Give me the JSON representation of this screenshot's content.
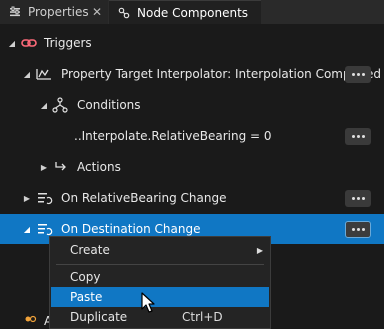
{
  "tabs": [
    {
      "label": "Properties",
      "icon": "properties-icon",
      "close": "✕"
    },
    {
      "label": "Node Components",
      "icon": "node-components-icon"
    }
  ],
  "tree": {
    "triggers": {
      "label": "Triggers",
      "icon": "link-icon"
    },
    "property_target": {
      "label": "Property Target Interpolator: Interpolation Completed",
      "icon": "interpolator-icon"
    },
    "conditions": {
      "label": "Conditions",
      "icon": "conditions-icon"
    },
    "condition_item": {
      "label": "..Interpolate.RelativeBearing = 0"
    },
    "actions": {
      "label": "Actions",
      "icon": "actions-icon"
    },
    "relative_bearing": {
      "label": "On RelativeBearing Change",
      "icon": "change-trigger-icon"
    },
    "destination": {
      "label": "On Destination Change",
      "icon": "change-trigger-icon"
    },
    "bottom_partial": {
      "label": "A"
    }
  },
  "context_menu": {
    "items": [
      {
        "label": "Create",
        "has_submenu": true
      },
      {
        "label": "Copy"
      },
      {
        "label": "Paste",
        "highlighted": true
      },
      {
        "label": "Duplicate",
        "shortcut": "Ctrl+D"
      }
    ]
  },
  "colors": {
    "selection": "#1077c4",
    "trigger_icon": "#ff6b7a",
    "background": "#1a1a1a"
  }
}
